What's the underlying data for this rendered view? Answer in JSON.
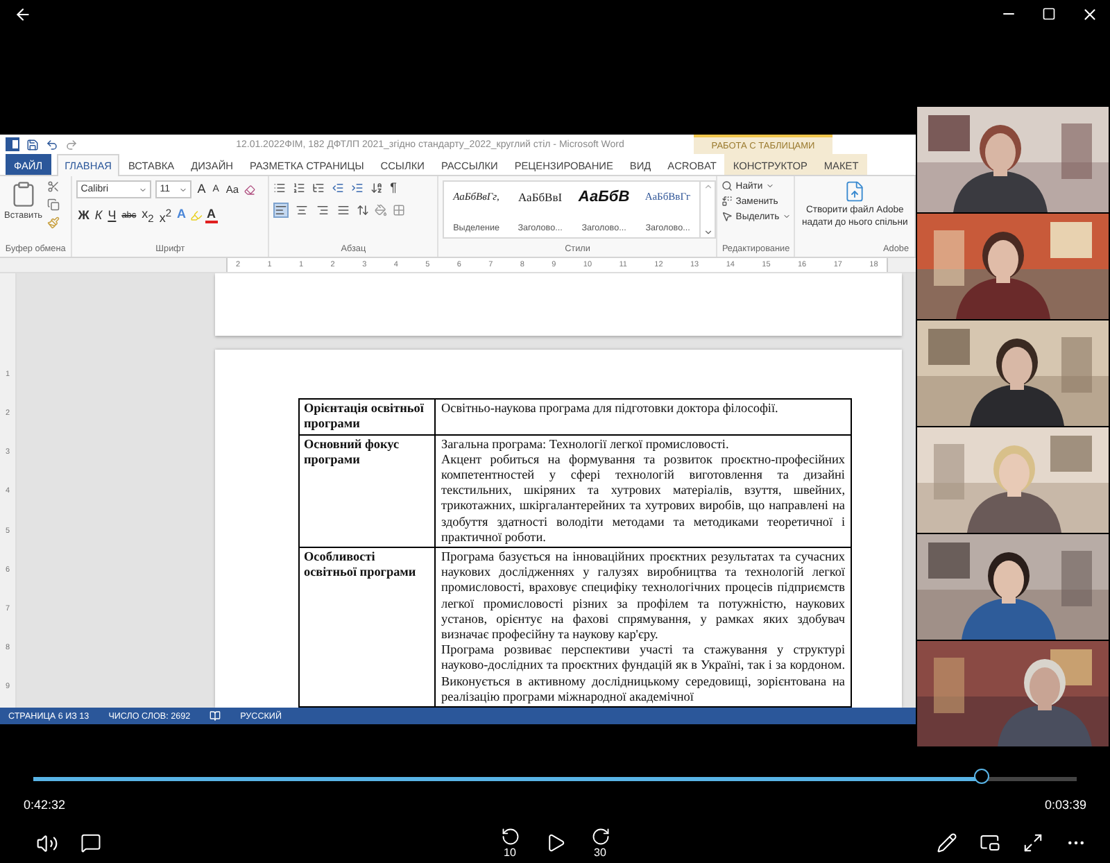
{
  "player": {
    "elapsed": "0:42:32",
    "remaining": "0:03:39",
    "level": 0.91,
    "skip_back": "10",
    "skip_forward": "30"
  },
  "word": {
    "title": "12.01.2022ФІМ, 182 ДФТЛП 2021_згідно стандарту_2022_круглий стіл - Microsoft Word",
    "context_group": "РАБОТА С ТАБЛИЦАМИ",
    "tabs": [
      {
        "label": "ФАЙЛ",
        "kind": "file",
        "selected": false
      },
      {
        "label": "ГЛАВНАЯ",
        "kind": "main",
        "selected": true
      },
      {
        "label": "ВСТАВКА",
        "kind": "main",
        "selected": false
      },
      {
        "label": "ДИЗАЙН",
        "kind": "main",
        "selected": false
      },
      {
        "label": "РАЗМЕТКА СТРАНИЦЫ",
        "kind": "main",
        "selected": false
      },
      {
        "label": "ССЫЛКИ",
        "kind": "main",
        "selected": false
      },
      {
        "label": "РАССЫЛКИ",
        "kind": "main",
        "selected": false
      },
      {
        "label": "РЕЦЕНЗИРОВАНИЕ",
        "kind": "main",
        "selected": false
      },
      {
        "label": "ВИД",
        "kind": "main",
        "selected": false
      },
      {
        "label": "ACROBAT",
        "kind": "main",
        "selected": false
      },
      {
        "label": "КОНСТРУКТОР",
        "kind": "context",
        "selected": false
      },
      {
        "label": "МАКЕТ",
        "kind": "context",
        "selected": false
      }
    ],
    "clipboard": {
      "paste": "Вставить"
    },
    "font": {
      "name": "Calibri",
      "size": "11",
      "grow": "A",
      "shrink": "A",
      "case": "Aa",
      "effects": "A",
      "font_color_letter": "A",
      "buttons": [
        {
          "label": "Ж",
          "kind": "bold"
        },
        {
          "label": "К",
          "kind": "italic"
        },
        {
          "label": "Ч",
          "kind": "underline"
        },
        {
          "label": "abc",
          "kind": "strike"
        },
        {
          "label": "x$_{2}$",
          "kind": "plain"
        },
        {
          "label": "x$^{2}$",
          "kind": "plain"
        }
      ]
    },
    "paragraph": {
      "pilcrow": "¶",
      "align_buttons": [
        {
          "kind": "left",
          "selected": true
        },
        {
          "kind": "center",
          "selected": false
        },
        {
          "kind": "right",
          "selected": false
        },
        {
          "kind": "justify",
          "selected": false
        }
      ]
    },
    "styles": [
      {
        "sample": "АаБбВвГг,",
        "name": "Выделение",
        "kind": "emphasis"
      },
      {
        "sample": "АаБбВвІ",
        "name": "Заголово...",
        "kind": "heading1"
      },
      {
        "sample": "АаБбВ",
        "name": "Заголово...",
        "kind": "title"
      },
      {
        "sample": "АаБбВвГг",
        "name": "Заголово...",
        "kind": "heading2"
      }
    ],
    "editing": [
      "Найти",
      "Заменить",
      "Выделить"
    ],
    "adobe": [
      "Створити файл Adobe",
      "надати до нього спільни"
    ],
    "groups": [
      "Буфер обмена",
      "Шрифт",
      "Абзац",
      "Стили",
      "Редактирование",
      "Adobe"
    ],
    "ruler": [
      "2",
      "1",
      "1",
      "2",
      "3",
      "4",
      "5",
      "6",
      "7",
      "8",
      "9",
      "10",
      "11",
      "12",
      "13",
      "14",
      "15",
      "16",
      "17",
      "18"
    ],
    "vruler": [
      "1",
      "2",
      "3",
      "4",
      "5",
      "6",
      "7",
      "8",
      "9"
    ],
    "table": [
      {
        "label": "Орієнтація освітньої програми",
        "paragraphs": [
          "Освітньо-наукова програма для підготовки доктора філософії."
        ]
      },
      {
        "label": "Основний фокус програми",
        "paragraphs": [
          "Загальна програма: Технології легкої промисловості.",
          "Акцент робиться на формування та розвиток проєктно-професійних компетентностей у сфері технологій виготовлення та дизайні текстильних, шкіряних та хутрових матеріалів, взуття, швейних, трикотажних, шкіргалантерейних та хутрових виробів, що направлені на здобуття здатності володіти методами та методиками теоретичної і практичної роботи."
        ]
      },
      {
        "label": "Особливості освітньої програми",
        "paragraphs": [
          "Програма базується на інноваційних проєктних результатах та сучасних наукових дослідженнях у галузях виробництва та технологій легкої промисловості, враховує специфіку технологічних процесів підприємств легкої промисловості різних за профілем та потужністю, наукових установ, орієнтує на фахові спрямування, у рамках яких здобувач визначає професійну та наукову кар'єру.",
          "Програма розвиває перспективи участі та стажування у структурі науково-дослідних та проєктних фундацій як в Україні, так і за кордоном. Виконується в активному дослідницькому середовищі, зорієнтована на реалізацію програми міжнародної академічної"
        ]
      }
    ],
    "status": {
      "page": "СТРАНИЦА 6 ИЗ 13",
      "words": "ЧИСЛО СЛОВ: 2692",
      "language": "РУССКИЙ"
    }
  }
}
